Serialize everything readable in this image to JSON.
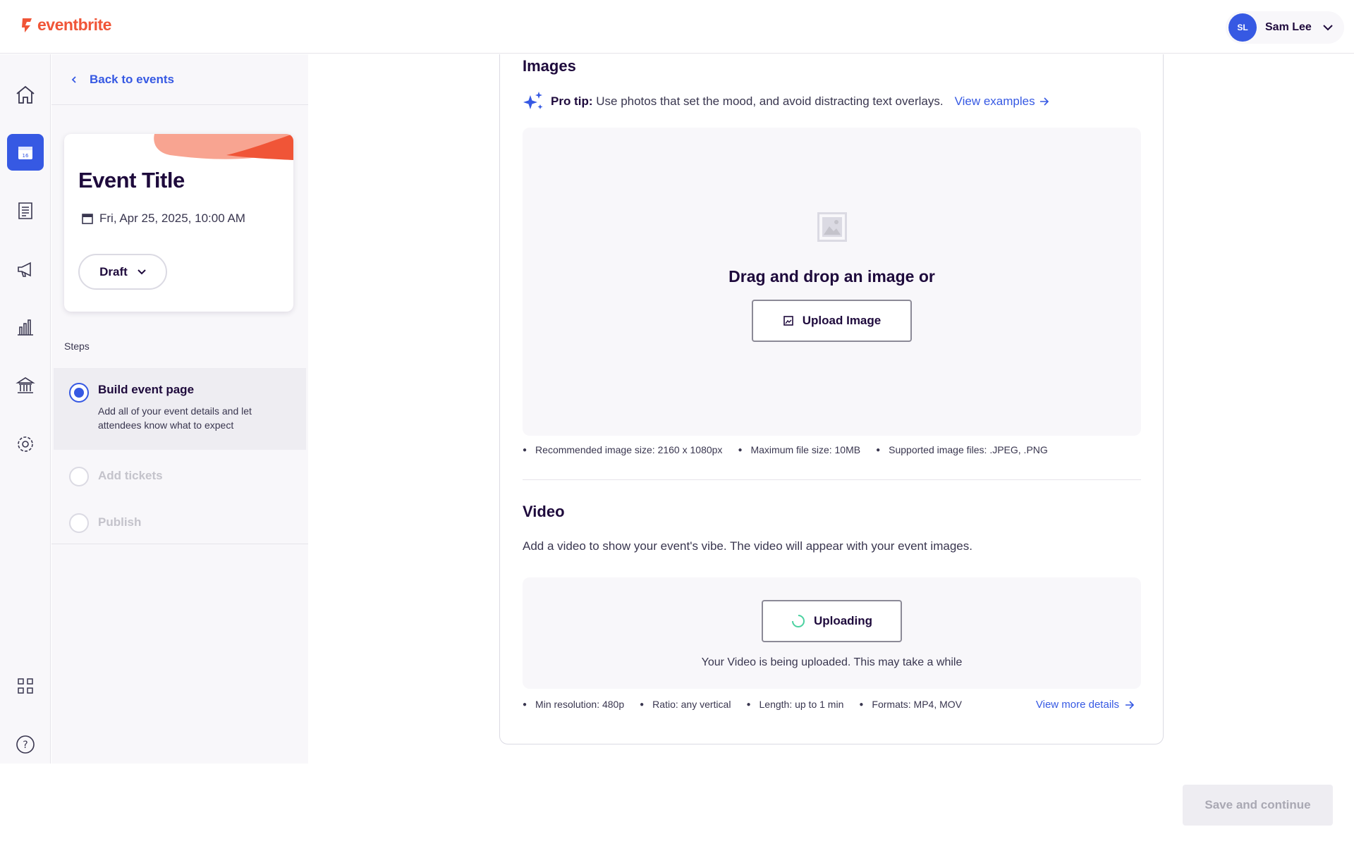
{
  "brand": {
    "name": "eventbrite",
    "accent": "#f05537",
    "primary": "#3659e3"
  },
  "user": {
    "initials": "SL",
    "name": "Sam Lee"
  },
  "rail": {
    "items": [
      "home-icon",
      "calendar-icon",
      "orders-icon",
      "megaphone-icon",
      "reports-icon",
      "finance-icon",
      "settings-icon",
      "apps-icon",
      "help-icon"
    ]
  },
  "sidebar": {
    "back_label": "Back to events",
    "event": {
      "title": "Event Title",
      "date": "Fri, Apr 25, 2025, 10:00 AM",
      "status": "Draft"
    },
    "steps_label": "Steps",
    "steps": [
      {
        "title": "Build event page",
        "desc": "Add all of your event details and let attendees know what to expect",
        "state": "active"
      },
      {
        "title": "Add tickets",
        "state": "disabled"
      },
      {
        "title": "Publish",
        "state": "disabled"
      }
    ]
  },
  "images": {
    "heading": "Images",
    "tip_bold": "Pro tip:",
    "tip_text": "Use photos that set the mood, and avoid distracting text overlays.",
    "tip_link": "View examples",
    "drop_text": "Drag and drop an image or",
    "upload_label": "Upload Image",
    "specs": [
      "Recommended image size: 2160 x 1080px",
      "Maximum file size: 10MB",
      "Supported image files: .JPEG, .PNG"
    ]
  },
  "video": {
    "heading": "Video",
    "desc": "Add a video to show your event's vibe. The video will appear with your event images.",
    "uploading_label": "Uploading",
    "upload_note": "Your Video is being uploaded. This may take a while",
    "specs": [
      "Min resolution: 480p",
      "Ratio: any vertical",
      "Length: up to 1 min",
      "Formats: MP4, MOV"
    ],
    "more_link": "View more details"
  },
  "footer": {
    "save_label": "Save and continue"
  }
}
